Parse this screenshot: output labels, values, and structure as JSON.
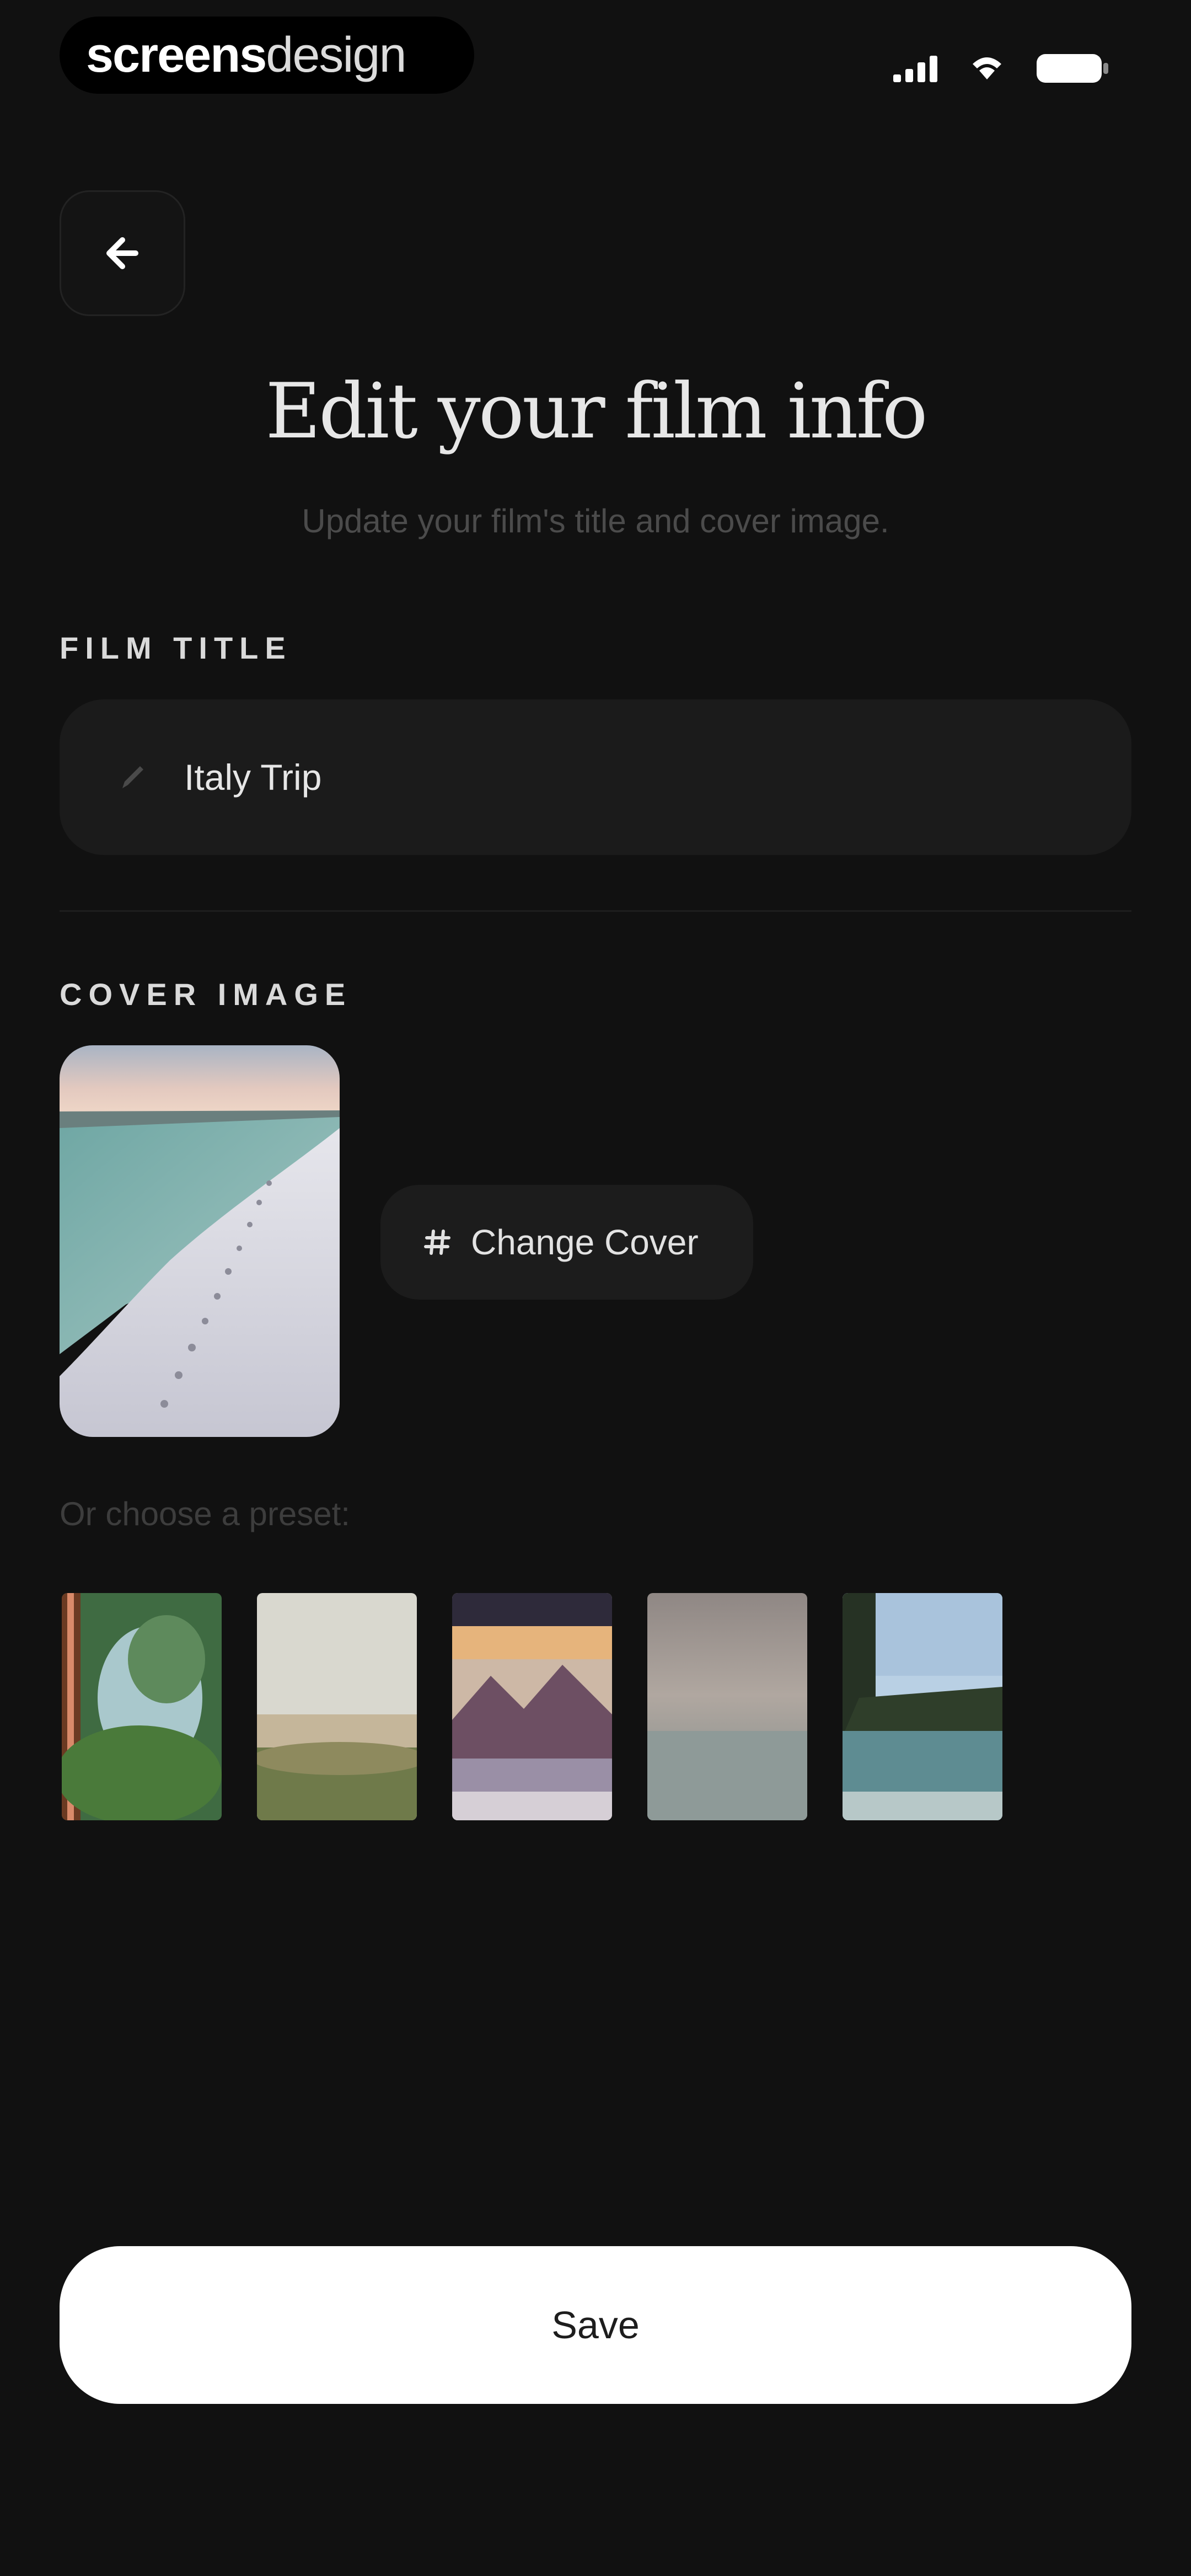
{
  "status_bar": {
    "brand_bold": "screens",
    "brand_light": "design"
  },
  "header": {
    "title": "Edit your film info",
    "subtitle": "Update your film's title and cover image."
  },
  "film_title": {
    "label": "FILM TITLE",
    "value": "Italy Trip"
  },
  "cover": {
    "label": "COVER IMAGE",
    "change_button_label": "Change Cover",
    "preset_label": "Or choose a preset:"
  },
  "footer": {
    "save_label": "Save"
  },
  "colors": {
    "background": "#111111",
    "field_background": "#1b1b1b",
    "save_button_background": "#ffffff",
    "save_button_text": "#1d1d1d"
  },
  "icons": {
    "back": "arrow-left-icon",
    "pencil": "pencil-icon",
    "change_cover": "hash-icon",
    "signal": "signal-icon",
    "wifi": "wifi-icon",
    "battery": "battery-icon"
  }
}
